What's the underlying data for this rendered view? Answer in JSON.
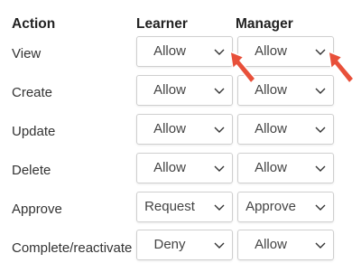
{
  "headers": {
    "action": "Action",
    "learner": "Learner",
    "manager": "Manager"
  },
  "rows": [
    {
      "action": "View",
      "learner": "Allow",
      "manager": "Allow"
    },
    {
      "action": "Create",
      "learner": "Allow",
      "manager": "Allow"
    },
    {
      "action": "Update",
      "learner": "Allow",
      "manager": "Allow"
    },
    {
      "action": "Delete",
      "learner": "Allow",
      "manager": "Allow"
    },
    {
      "action": "Approve",
      "learner": "Request",
      "manager": "Approve"
    },
    {
      "action": "Complete/reactivate",
      "learner": "Deny",
      "manager": "Allow"
    }
  ],
  "icons": {
    "dropdown": "chevron-down-icon",
    "pointer": "red-arrow-icon"
  },
  "colors": {
    "arrow": "#e8503a",
    "border": "#cfcfcf"
  }
}
